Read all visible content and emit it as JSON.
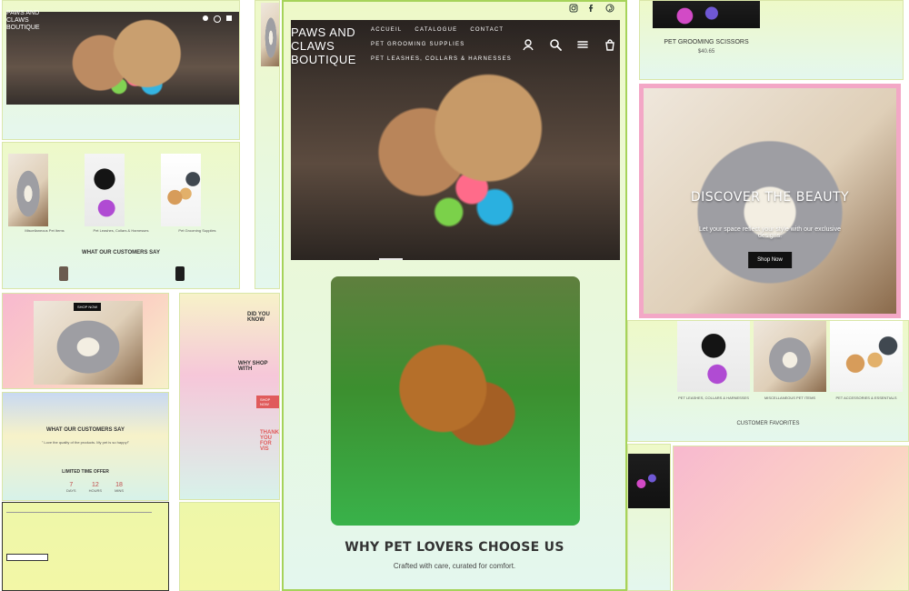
{
  "main": {
    "brand": "PAWS AND CLAWS BOUTIQUE",
    "nav_primary": [
      "ACCUEIL",
      "CATALOGUE",
      "CONTACT"
    ],
    "nav_secondary": [
      "PET GROOMING SUPPLIES",
      "PET LEASHES, COLLARS & HARNESSES"
    ],
    "social_icons": [
      "instagram-icon",
      "facebook-icon",
      "pinterest-icon"
    ],
    "header_icons": [
      "account-icon",
      "search-icon",
      "menu-icon",
      "cart-icon"
    ],
    "section_title": "WHY PET LOVERS CHOOSE US",
    "section_sub": "Crafted with care, curated for comfort."
  },
  "tiles": {
    "t2": {
      "products": [
        "Miscellaneous Pet Items",
        "Pet Leashes, Collars & Harnesses",
        "Pet Grooming Supplies"
      ],
      "testimonials_title": "WHAT OUR CUSTOMERS SAY"
    },
    "t4": {
      "testimonials_title": "WHAT OUR CUSTOMERS SAY",
      "quote": "\" Love the quality of the products. My pet is so happy!\"",
      "offer_title": "LIMITED TIME OFFER",
      "countdown": [
        "7",
        "12",
        "18"
      ],
      "countdown_labels": [
        "DAYS",
        "HOURS",
        "MINS"
      ]
    },
    "t6": {
      "title1": "DID YOU KNOW",
      "title2": "WHY SHOP WITH",
      "title3": "THANK YOU FOR VIS",
      "button": "SHOP NOW"
    },
    "t9": {
      "product": "PET GROOMING SCISSORS",
      "price": "$40.65"
    },
    "t10": {
      "title": "DISCOVER THE BEAUTY",
      "sub": "Let your space reflect your style with our exclusive designs.",
      "button": "Shop Now"
    },
    "t11": {
      "products": [
        "PET LEASHES, COLLARS & HARNESSES",
        "MISCELLANEOUS PET ITEMS",
        "PET ACCESSORIES & ESSENTIALS"
      ],
      "favorites": "CUSTOMER FAVORITES"
    }
  }
}
